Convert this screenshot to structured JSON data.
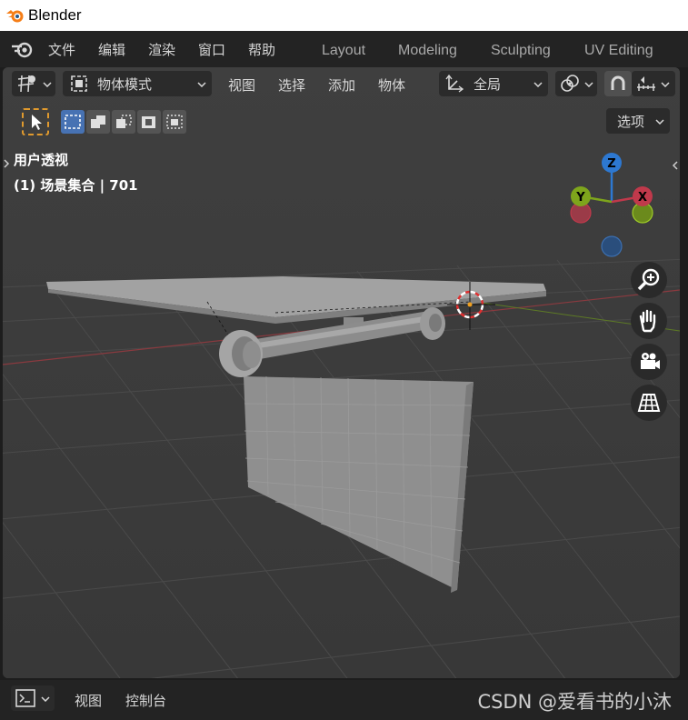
{
  "window": {
    "title": "Blender"
  },
  "menubar": {
    "items": [
      "文件",
      "编辑",
      "渲染",
      "窗口",
      "帮助"
    ],
    "workspaces": [
      "Layout",
      "Modeling",
      "Sculpting",
      "UV Editing"
    ]
  },
  "viewport_header": {
    "mode_label": "物体模式",
    "menus": [
      "视图",
      "选择",
      "添加",
      "物体"
    ],
    "transform_orientation": "全局",
    "options_label": "选项"
  },
  "overlay": {
    "view_name": "用户透视",
    "collection_info": "(1) 场景集合 | 701"
  },
  "gizmo": {
    "z": "Z",
    "y": "Y",
    "x": "X"
  },
  "bottom_bar": {
    "menus": [
      "视图",
      "控制台"
    ],
    "watermark": "CSDN @爱看书的小沐"
  },
  "colors": {
    "axis_x": "#c0394b",
    "axis_y": "#7ea51c",
    "axis_z": "#2d78d1",
    "selection_blue": "#4772b3",
    "viewport_bg": "#3d3d3d"
  }
}
